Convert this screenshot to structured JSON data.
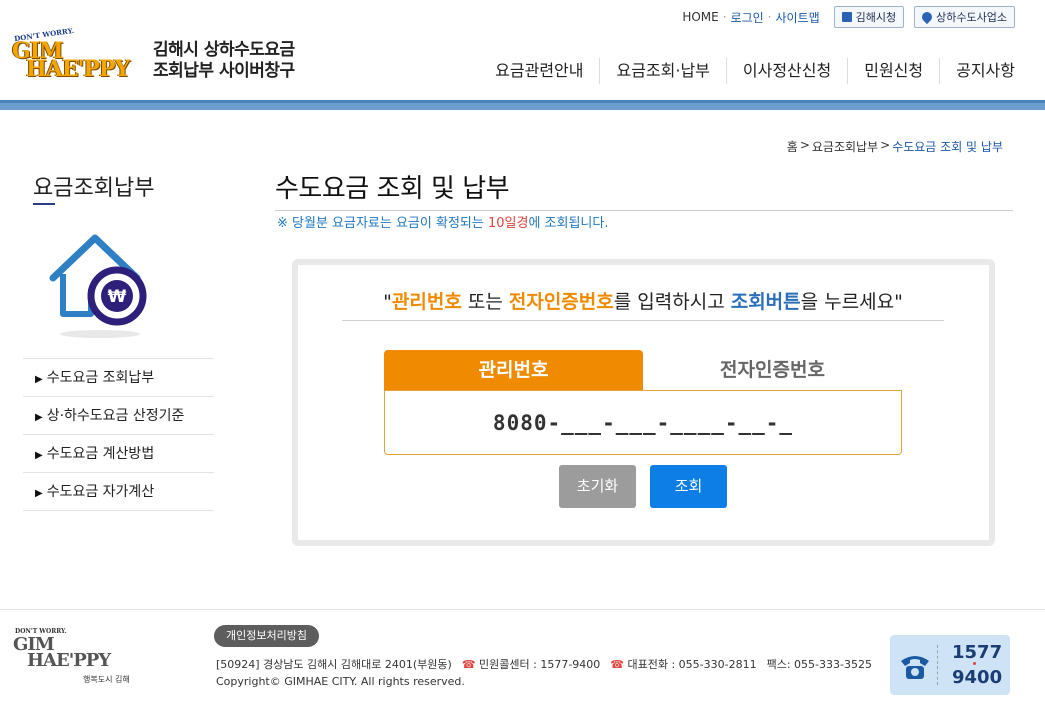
{
  "util": {
    "home": "HOME",
    "login": "로그인",
    "sitemap": "사이트맵",
    "btn_city": "김해시청",
    "btn_office": "상하수도사업소"
  },
  "logo": {
    "tag": "DON'T WORRY.",
    "word1": "GIM",
    "word2": "HAE'PPY"
  },
  "site_title": [
    "김해시 상하수도요금",
    "조회납부 사이버창구"
  ],
  "gnb": [
    "요금관련안내",
    "요금조회·납부",
    "이사정산신청",
    "민원신청",
    "공지사항"
  ],
  "breadcrumb": {
    "home": "홈",
    "sep": ">",
    "section": "요금조회납부",
    "current": "수도요금 조회 및 납부"
  },
  "sidebar": {
    "title": "요금조회납부",
    "icon": "house-won-icon",
    "items": [
      "수도요금 조회납부",
      "상·하수도요금 산정기준",
      "수도요금 계산방법",
      "수도요금 자가계산"
    ],
    "bullet": "▶"
  },
  "main": {
    "title": "수도요금 조회 및 납부",
    "notice_pre": "※ 당월분 요금자료는 요금이 확정되는 ",
    "notice_red": "10일경",
    "notice_post": "에 조회됩니다.",
    "prompt": {
      "q_open": "\"",
      "p1": "관리번호",
      "p2": " 또는 ",
      "p3": "전자인증번호",
      "p4": "를 입력하시고 ",
      "p5": "조회버튼",
      "p6": "을 누르세요",
      "q_close": "\""
    },
    "tab_active": "관리번호",
    "tab_idle": "전자인증번호",
    "input_value": "8080-___-___-____-__-_",
    "btn_reset": "초기화",
    "btn_search": "조회"
  },
  "footer": {
    "logo_tag": "DON'T WORRY.",
    "logo_w1": "GIM",
    "logo_w2": "HAE'PPY",
    "logo_sub": "행복도시 김해",
    "privacy": "개인정보처리방침",
    "address": "[50924] 경상남도 김해시 김해대로 2401(부원동)",
    "center": "민원콜센터 : 1577-9400",
    "main_tel": "대표전화 : 055-330-2811",
    "fax": "팩스: 055-333-3525",
    "copyright": "Copyright© GIMHAE CITY. All rights reserved.",
    "call_n1": "1577",
    "call_n2": "9400"
  },
  "colors": {
    "accent_orange": "#f08a00",
    "accent_blue": "#0c7ee6",
    "bar_blue": "#6c9ecd",
    "notice_blue": "#1f77c0",
    "notice_red": "#e0443c"
  }
}
